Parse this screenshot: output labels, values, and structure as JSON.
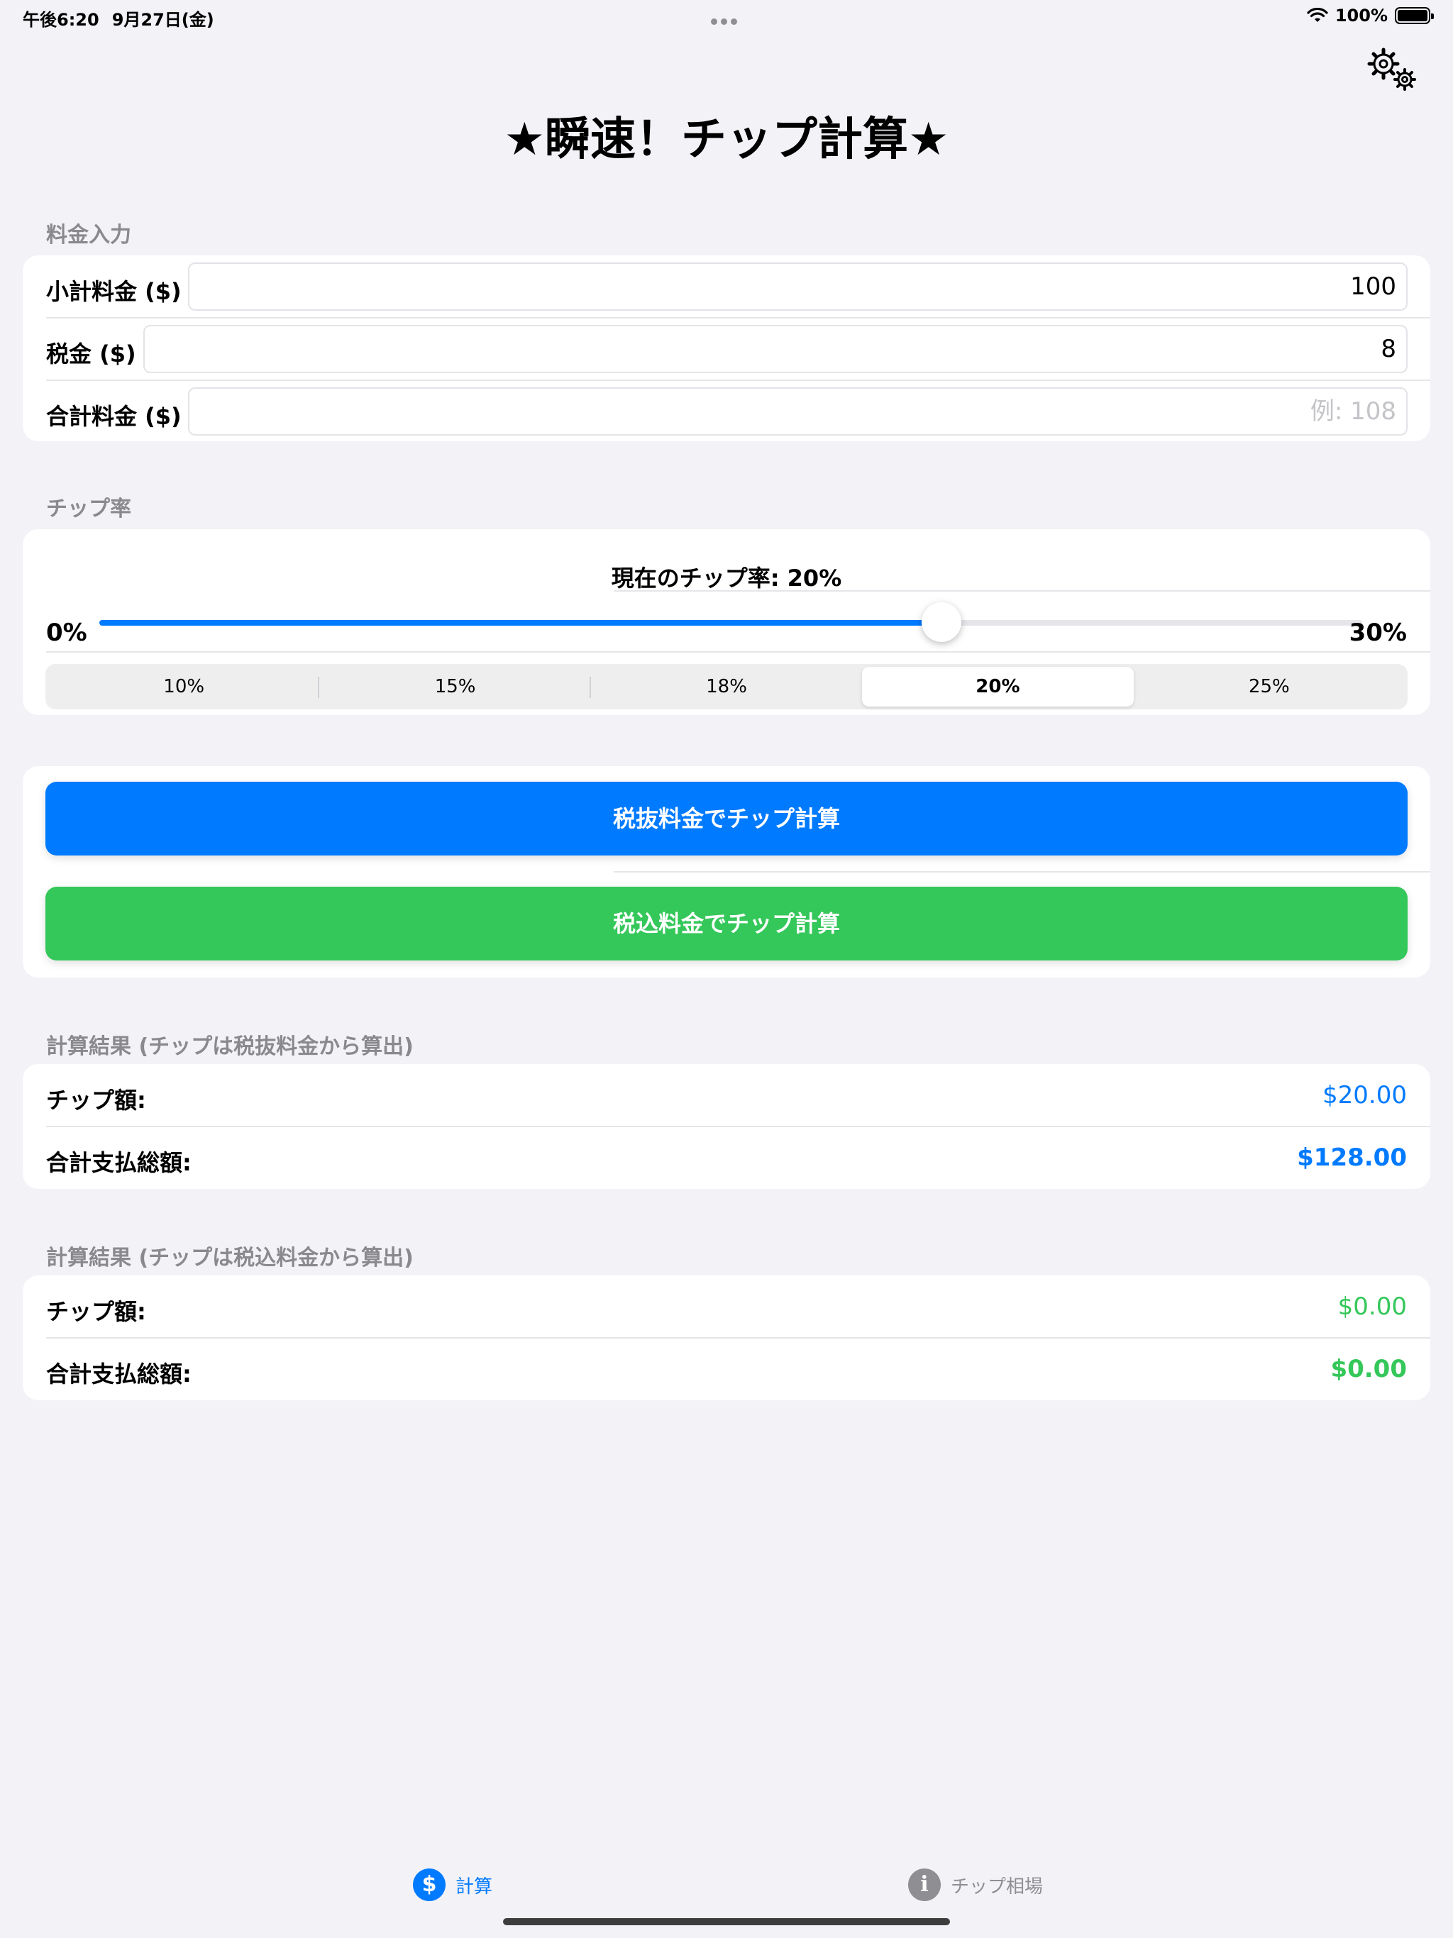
{
  "status_bar": {
    "time": "午後6:20",
    "date": "9月27日(金)",
    "battery": "100%"
  },
  "app": {
    "title": "★瞬速！チップ計算★"
  },
  "input_section": {
    "label": "料金入力",
    "subtotal": {
      "label": "小計料金 ($)",
      "value": "100"
    },
    "tax": {
      "label": "税金 ($)",
      "value": "8"
    },
    "total": {
      "label": "合計料金 ($)",
      "placeholder": "例: 108"
    }
  },
  "tip_section": {
    "label": "チップ率",
    "current_rate": "現在のチップ率: 20%",
    "slider": {
      "min_label": "0%",
      "max_label": "30%",
      "value": 20,
      "min": 0,
      "max": 30
    },
    "presets": [
      "10%",
      "15%",
      "18%",
      "20%",
      "25%"
    ],
    "selected_preset": 3
  },
  "buttons": {
    "pre_tax": "税抜料金でチップ計算",
    "post_tax": "税込料金でチップ計算"
  },
  "result_pre_tax": {
    "label": "計算結果 (チップは税抜料金から算出)",
    "tip_label": "チップ額:",
    "tip_value": "$20.00",
    "total_label": "合計支払総額:",
    "total_value": "$128.00"
  },
  "result_post_tax": {
    "label": "計算結果 (チップは税込料金から算出)",
    "tip_label": "チップ額:",
    "tip_value": "$0.00",
    "total_label": "合計支払総額:",
    "total_value": "$0.00"
  },
  "tabs": [
    {
      "label": "計算",
      "icon": "dollar-icon",
      "glyph": "$",
      "active": true
    },
    {
      "label": "チップ相場",
      "icon": "info-icon",
      "glyph": "i",
      "active": false
    }
  ],
  "colors": {
    "accent_blue": "#007aff",
    "accent_green": "#34c759",
    "background": "#f2f2f7"
  }
}
